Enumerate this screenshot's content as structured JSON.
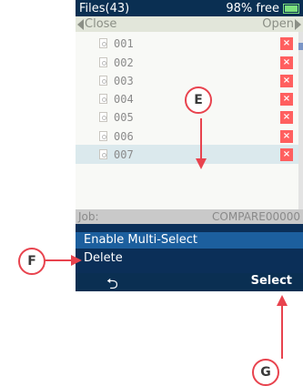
{
  "title": {
    "files": "Files(43)",
    "free": "98% free",
    "battery_level": 0.98
  },
  "nav": {
    "close": "Close",
    "open": "Open"
  },
  "files": [
    {
      "name": "001"
    },
    {
      "name": "002"
    },
    {
      "name": "003"
    },
    {
      "name": "004"
    },
    {
      "name": "005"
    },
    {
      "name": "006"
    },
    {
      "name": "007",
      "selected": true
    }
  ],
  "job": {
    "label": "Job:",
    "value": "COMPARE00000"
  },
  "menu": {
    "items": [
      "Enable Multi-Select",
      "Delete"
    ],
    "highlighted": 0
  },
  "softkeys": {
    "back": "⮌",
    "select": "Select"
  },
  "callouts": {
    "e": "E",
    "f": "F",
    "g": "G"
  },
  "colors": {
    "accent": "#e8434e",
    "title_bg": "#0a2f52",
    "menu_bg": "#0b2f58",
    "highlight": "#1c5f9e",
    "delete": "#ff5f5f"
  }
}
